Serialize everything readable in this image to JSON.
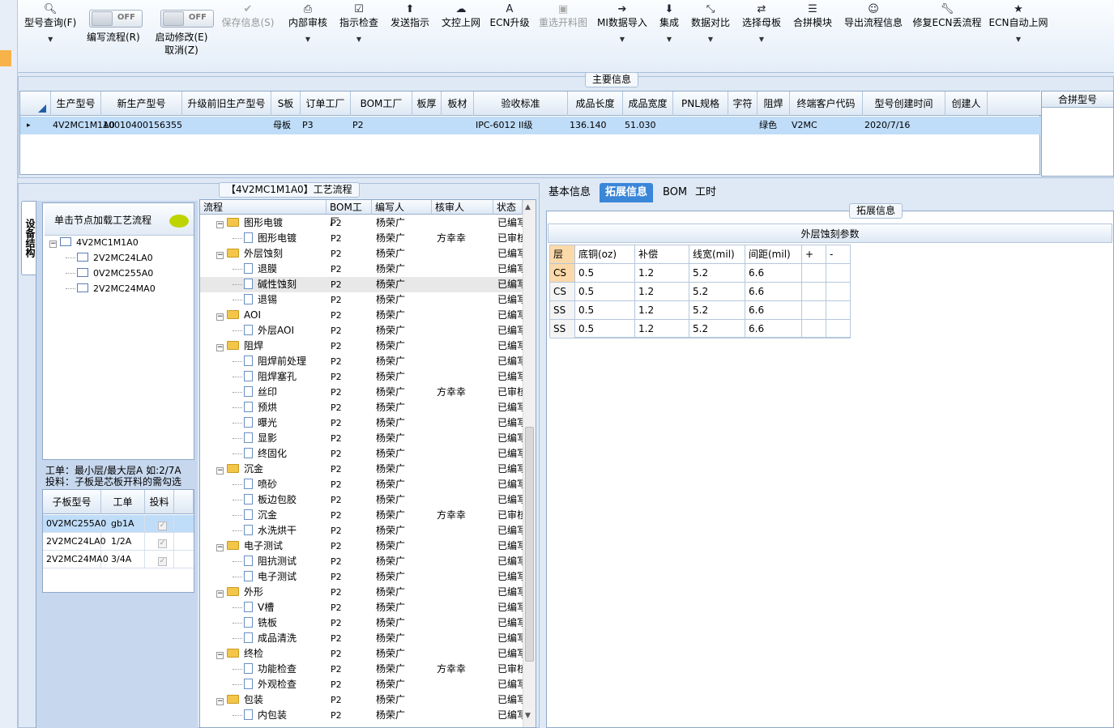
{
  "toolbar": {
    "buttons": [
      {
        "icon": "search-icon",
        "label": "型号查询(F)",
        "dropdown": true
      },
      {
        "icon": "save-icon",
        "label": "保存信息(S)",
        "disabled": true
      },
      {
        "icon": "print-icon",
        "label": "内部审核",
        "dropdown": true
      },
      {
        "icon": "checklist-icon",
        "label": "指示检查",
        "dropdown": true
      },
      {
        "icon": "upload-icon",
        "label": "发送指示"
      },
      {
        "icon": "cloud-upload-icon",
        "label": "文控上网"
      },
      {
        "icon": "ecn-icon",
        "label": "ECN升级"
      },
      {
        "icon": "image-icon",
        "label": "重选开料图",
        "disabled": true
      },
      {
        "icon": "import-icon",
        "label": "MI数据导入",
        "dropdown": true
      },
      {
        "icon": "download-icon",
        "label": "集成",
        "dropdown": true
      },
      {
        "icon": "compare-icon",
        "label": "数据对比",
        "dropdown": true
      },
      {
        "icon": "shuffle-icon",
        "label": "选择母板",
        "dropdown": true
      },
      {
        "icon": "list-icon",
        "label": "合拼模块"
      },
      {
        "icon": "smile-icon",
        "label": "导出流程信息"
      },
      {
        "icon": "wrench-icon",
        "label": "修复ECN丢流程"
      },
      {
        "icon": "star-icon",
        "label": "ECN自动上网",
        "dropdown": true
      }
    ],
    "toggles": [
      {
        "state": "OFF",
        "label": "编写流程(R)"
      },
      {
        "state": "OFF",
        "label": "启动修改(E)",
        "label2": "取消(Z)"
      }
    ]
  },
  "main_info": {
    "caption": "主要信息",
    "columns": [
      "生产型号",
      "新生产型号",
      "升级前旧生产型号",
      "S板",
      "订单工厂",
      "BOM工厂",
      "板厚",
      "板材",
      "验收标准",
      "成品长度",
      "成品宽度",
      "PNL规格",
      "字符",
      "阻焊",
      "终端客户代码",
      "型号创建时间",
      "创建人"
    ],
    "row": [
      "4V2MC1M1A0",
      "10010400156355",
      "",
      "母板",
      "P3",
      "P2",
      "",
      "",
      "IPC-6012 II级",
      "136.140",
      "51.030",
      "",
      "",
      "绿色",
      "V2MC",
      "2020/7/16",
      ""
    ]
  },
  "merge_box": {
    "title": "合拼型号"
  },
  "left_tab": {
    "label": "设备结构"
  },
  "tree": {
    "load_button": "单击节点加载工艺流程",
    "root": "4V2MC1M1A0",
    "children": [
      "2V2MC24LA0",
      "0V2MC255A0",
      "2V2MC24MA0"
    ]
  },
  "notes": [
    "工单：最小层/最大层A 如:2/7A",
    "投料：子板是芯板开料的需勾选"
  ],
  "subgrid": {
    "columns": [
      "子板型号",
      "工单",
      "投料"
    ],
    "rows": [
      [
        "0V2MC255A0",
        "gb1A"
      ],
      [
        "2V2MC24LA0",
        "1/2A"
      ],
      [
        "2V2MC24MA0",
        "3/4A"
      ]
    ]
  },
  "flow": {
    "caption": "【4V2MC1M1A0】工艺流程",
    "columns": [
      "流程",
      "BOM工厂",
      "编写人",
      "核审人",
      "状态"
    ],
    "rows": [
      {
        "type": "g",
        "name": "图形电镀",
        "bom": "P2",
        "writer": "杨荣广",
        "checker": "",
        "status": "已编写"
      },
      {
        "type": "i",
        "name": "图形电镀",
        "bom": "P2",
        "writer": "杨荣广",
        "checker": "方幸幸",
        "status": "已审核"
      },
      {
        "type": "g",
        "name": "外层蚀刻",
        "bom": "P2",
        "writer": "杨荣广",
        "checker": "",
        "status": "已编写"
      },
      {
        "type": "i",
        "name": "退膜",
        "bom": "P2",
        "writer": "杨荣广",
        "checker": "",
        "status": "已编写"
      },
      {
        "type": "i",
        "name": "碱性蚀刻",
        "bom": "P2",
        "writer": "杨荣广",
        "checker": "",
        "status": "已编写",
        "sel": true
      },
      {
        "type": "i",
        "name": "退锡",
        "bom": "P2",
        "writer": "杨荣广",
        "checker": "",
        "status": "已编写"
      },
      {
        "type": "g",
        "name": "AOI",
        "bom": "P2",
        "writer": "杨荣广",
        "checker": "",
        "status": "已编写"
      },
      {
        "type": "i",
        "name": "外层AOI",
        "bom": "P2",
        "writer": "杨荣广",
        "checker": "",
        "status": "已编写"
      },
      {
        "type": "g",
        "name": "阻焊",
        "bom": "P2",
        "writer": "杨荣广",
        "checker": "",
        "status": "已编写"
      },
      {
        "type": "i",
        "name": "阻焊前处理",
        "bom": "P2",
        "writer": "杨荣广",
        "checker": "",
        "status": "已编写"
      },
      {
        "type": "i",
        "name": "阻焊塞孔",
        "bom": "P2",
        "writer": "杨荣广",
        "checker": "",
        "status": "已编写"
      },
      {
        "type": "i",
        "name": "丝印",
        "bom": "P2",
        "writer": "杨荣广",
        "checker": "方幸幸",
        "status": "已审核"
      },
      {
        "type": "i",
        "name": "预烘",
        "bom": "P2",
        "writer": "杨荣广",
        "checker": "",
        "status": "已编写"
      },
      {
        "type": "i",
        "name": "曝光",
        "bom": "P2",
        "writer": "杨荣广",
        "checker": "",
        "status": "已编写"
      },
      {
        "type": "i",
        "name": "显影",
        "bom": "P2",
        "writer": "杨荣广",
        "checker": "",
        "status": "已编写"
      },
      {
        "type": "i",
        "name": "终固化",
        "bom": "P2",
        "writer": "杨荣广",
        "checker": "",
        "status": "已编写"
      },
      {
        "type": "g",
        "name": "沉金",
        "bom": "P2",
        "writer": "杨荣广",
        "checker": "",
        "status": "已编写"
      },
      {
        "type": "i",
        "name": "喷砂",
        "bom": "P2",
        "writer": "杨荣广",
        "checker": "",
        "status": "已编写"
      },
      {
        "type": "i",
        "name": "板边包胶",
        "bom": "P2",
        "writer": "杨荣广",
        "checker": "",
        "status": "已编写"
      },
      {
        "type": "i",
        "name": "沉金",
        "bom": "P2",
        "writer": "杨荣广",
        "checker": "方幸幸",
        "status": "已审核"
      },
      {
        "type": "i",
        "name": "水洗烘干",
        "bom": "P2",
        "writer": "杨荣广",
        "checker": "",
        "status": "已编写"
      },
      {
        "type": "g",
        "name": "电子测试",
        "bom": "P2",
        "writer": "杨荣广",
        "checker": "",
        "status": "已编写"
      },
      {
        "type": "i",
        "name": "阻抗测试",
        "bom": "P2",
        "writer": "杨荣广",
        "checker": "",
        "status": "已编写"
      },
      {
        "type": "i",
        "name": "电子测试",
        "bom": "P2",
        "writer": "杨荣广",
        "checker": "",
        "status": "已编写"
      },
      {
        "type": "g",
        "name": "外形",
        "bom": "P2",
        "writer": "杨荣广",
        "checker": "",
        "status": "已编写"
      },
      {
        "type": "i",
        "name": "V槽",
        "bom": "P2",
        "writer": "杨荣广",
        "checker": "",
        "status": "已编写"
      },
      {
        "type": "i",
        "name": "铣板",
        "bom": "P2",
        "writer": "杨荣广",
        "checker": "",
        "status": "已编写"
      },
      {
        "type": "i",
        "name": "成品清洗",
        "bom": "P2",
        "writer": "杨荣广",
        "checker": "",
        "status": "已编写"
      },
      {
        "type": "g",
        "name": "终检",
        "bom": "P2",
        "writer": "杨荣广",
        "checker": "",
        "status": "已编写"
      },
      {
        "type": "i",
        "name": "功能检查",
        "bom": "P2",
        "writer": "杨荣广",
        "checker": "方幸幸",
        "status": "已审核"
      },
      {
        "type": "i",
        "name": "外观检查",
        "bom": "P2",
        "writer": "杨荣广",
        "checker": "",
        "status": "已编写"
      },
      {
        "type": "g",
        "name": "包装",
        "bom": "P2",
        "writer": "杨荣广",
        "checker": "",
        "status": "已编写"
      },
      {
        "type": "i",
        "name": "内包装",
        "bom": "P2",
        "writer": "杨荣广",
        "checker": "",
        "status": "已编写"
      }
    ]
  },
  "right": {
    "tabs": [
      "基本信息",
      "拓展信息",
      "BOM",
      "工时"
    ],
    "active_tab": "拓展信息",
    "card_caption": "拓展信息",
    "table_title": "外层蚀刻参数",
    "columns": [
      "层",
      "底铜(oz)",
      "补偿",
      "线宽(mil)",
      "间距(mil)",
      "+",
      "-"
    ],
    "rows": [
      [
        "CS",
        "0.5",
        "1.2",
        "5.2",
        "6.6"
      ],
      [
        "CS",
        "0.5",
        "1.2",
        "5.2",
        "6.6"
      ],
      [
        "SS",
        "0.5",
        "1.2",
        "5.2",
        "6.6"
      ],
      [
        "SS",
        "0.5",
        "1.2",
        "5.2",
        "6.6"
      ]
    ]
  },
  "colors": {
    "selection": "#bfdcf8",
    "tab_active": "#3a86d8",
    "highlight": "#f7b24a"
  }
}
